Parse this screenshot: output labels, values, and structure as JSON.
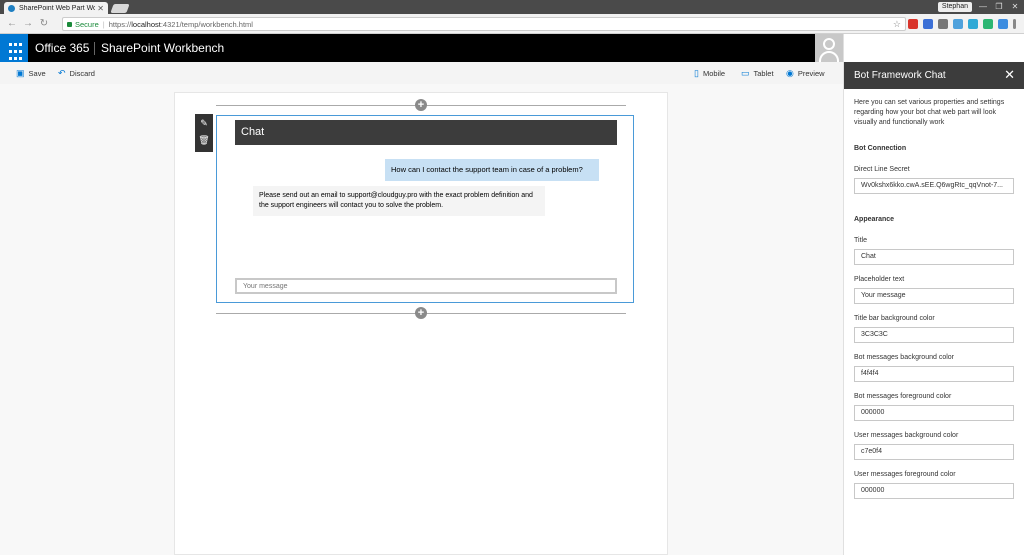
{
  "browser": {
    "tab_title": "SharePoint Web Part Wo",
    "profile": "Stephan",
    "secure_label": "Secure",
    "url_scheme": "https://",
    "url_host": "localhost",
    "url_path": ":4321/temp/workbench.html"
  },
  "suite": {
    "brand": "Office 365",
    "product": "SharePoint Workbench"
  },
  "commands": {
    "save": "Save",
    "discard": "Discard",
    "mobile": "Mobile",
    "tablet": "Tablet",
    "preview": "Preview"
  },
  "chat": {
    "title": "Chat",
    "user_message": "How can I contact the support team in case of a problem?",
    "bot_message": "Please send out an email to support@cloudguy.pro with the exact problem definition and the support engineers will contact you to solve the problem.",
    "input_placeholder": "Your message"
  },
  "pane": {
    "title": "Bot Framework Chat",
    "description": "Here you can set various properties and settings regarding how your bot chat web part will look visually and functionally work",
    "bot_connection_heading": "Bot Connection",
    "appearance_heading": "Appearance",
    "fields": {
      "secret": {
        "label": "Direct Line Secret",
        "value": "Wv0kshx6kko.cwA.sEE.Q6wgRtc_qqVnot-7..."
      },
      "title": {
        "label": "Title",
        "value": "Chat"
      },
      "placeholder": {
        "label": "Placeholder text",
        "value": "Your message"
      },
      "titlebar_bg": {
        "label": "Title bar background color",
        "value": "3C3C3C"
      },
      "bot_bg": {
        "label": "Bot messages background color",
        "value": "f4f4f4"
      },
      "bot_fg": {
        "label": "Bot messages foreground color",
        "value": "000000"
      },
      "user_bg": {
        "label": "User messages background color",
        "value": "c7e0f4"
      },
      "user_fg": {
        "label": "User messages foreground color",
        "value": "000000"
      }
    }
  },
  "colors": {
    "title_bar": "#3c3c3c",
    "bot_bg": "#f4f4f4",
    "user_bg": "#c7e0f4",
    "accent": "#0078d4"
  }
}
